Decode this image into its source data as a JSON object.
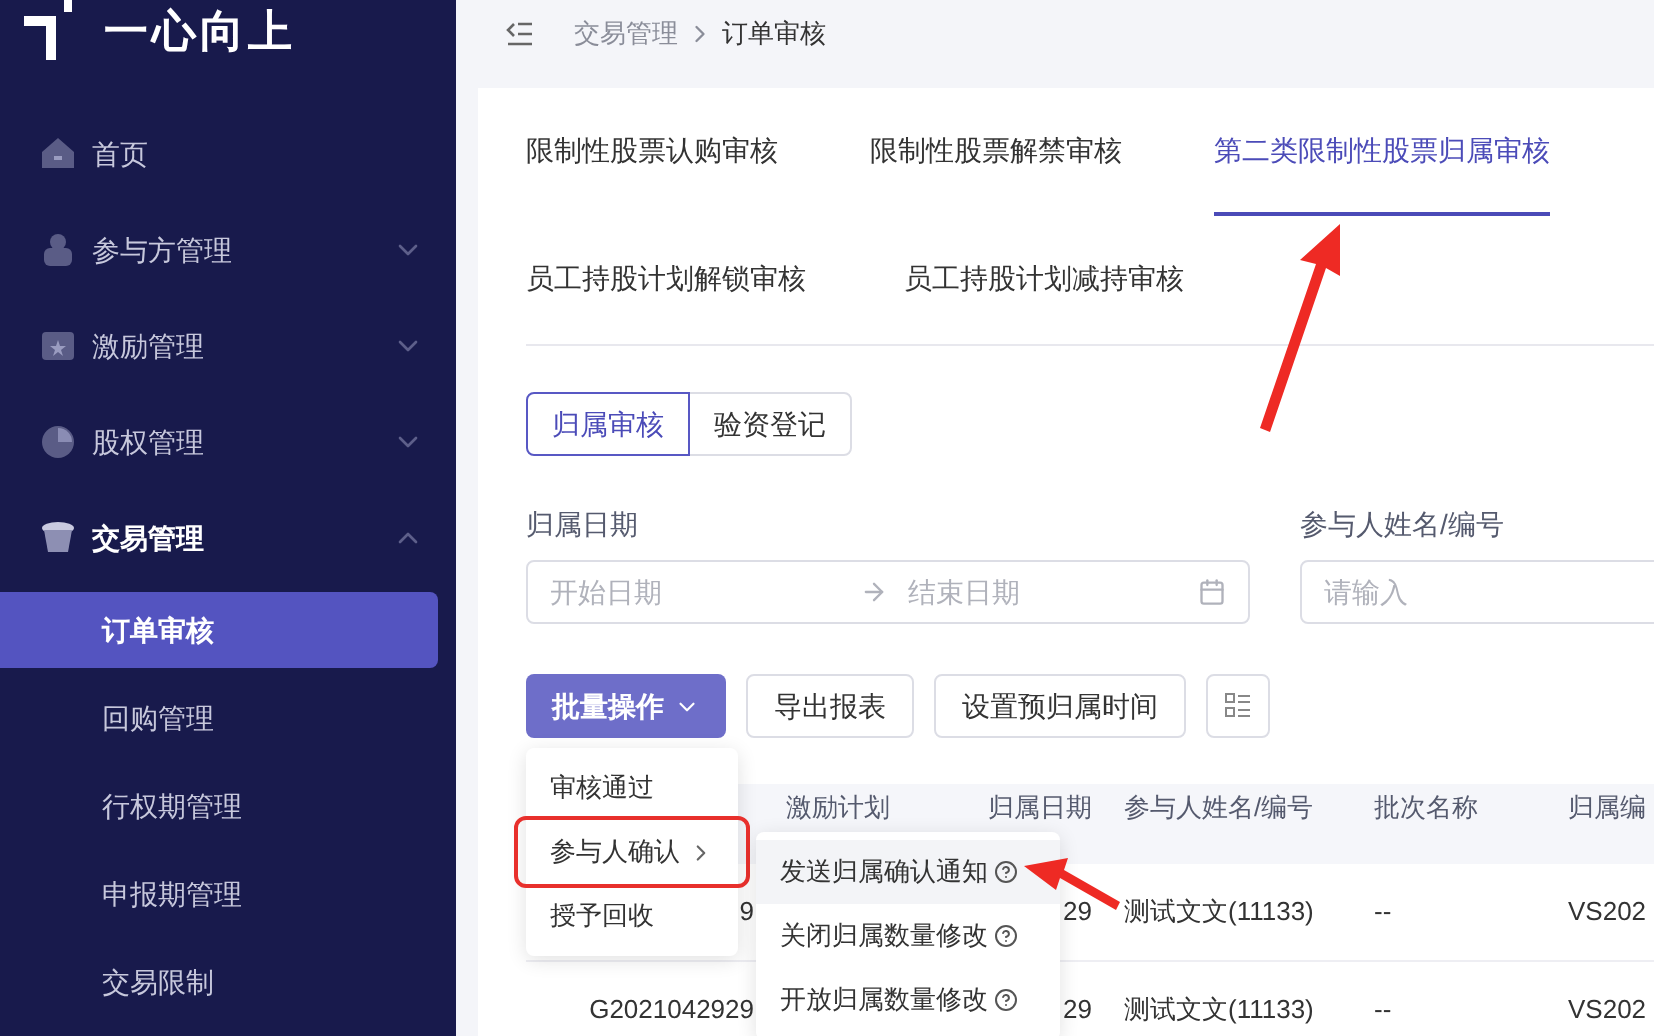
{
  "sidebar": {
    "logo": "一心向上",
    "items": [
      {
        "label": "首页",
        "expandable": false
      },
      {
        "label": "参与方管理",
        "expandable": true,
        "expanded": false
      },
      {
        "label": "激励管理",
        "expandable": true,
        "expanded": false
      },
      {
        "label": "股权管理",
        "expandable": true,
        "expanded": false
      },
      {
        "label": "交易管理",
        "expandable": true,
        "expanded": true,
        "children": [
          {
            "label": "订单审核",
            "selected": true
          },
          {
            "label": "回购管理",
            "selected": false
          },
          {
            "label": "行权期管理",
            "selected": false
          },
          {
            "label": "申报期管理",
            "selected": false
          },
          {
            "label": "交易限制",
            "selected": false
          }
        ]
      }
    ]
  },
  "breadcrumb": [
    "交易管理",
    "订单审核"
  ],
  "tabs": [
    [
      {
        "label": "限制性股票认购审核",
        "selected": false
      },
      {
        "label": "限制性股票解禁审核",
        "selected": false
      },
      {
        "label": "第二类限制性股票归属审核",
        "selected": true
      }
    ],
    [
      {
        "label": "员工持股计划解锁审核",
        "selected": false
      },
      {
        "label": "员工持股计划减持审核",
        "selected": false
      }
    ]
  ],
  "segments": [
    {
      "label": "归属审核",
      "selected": true
    },
    {
      "label": "验资登记",
      "selected": false
    }
  ],
  "filters": {
    "date_label": "归属日期",
    "date_start_placeholder": "开始日期",
    "date_end_placeholder": "结束日期",
    "name_label": "参与人姓名/编号",
    "name_placeholder": "请输入"
  },
  "toolbar": {
    "batch": "批量操作",
    "export": "导出报表",
    "set_time": "设置预归属时间"
  },
  "table": {
    "columns": [
      "",
      "激励计划",
      "归属日期",
      "参与人姓名/编号",
      "批次名称",
      "归属编"
    ],
    "rows": [
      [
        "9",
        "",
        "29",
        "测试文文(11133)",
        "--",
        "VS202"
      ],
      [
        "G2021042929",
        "",
        "29",
        "测试文文(11133)",
        "--",
        "VS202"
      ]
    ]
  },
  "batch_menu": [
    {
      "label": "审核通过",
      "submenu": false,
      "highlighted": false
    },
    {
      "label": "参与人确认",
      "submenu": true,
      "highlighted": true
    },
    {
      "label": "授予回收",
      "submenu": false,
      "highlighted": false
    }
  ],
  "submenu": [
    {
      "label": "发送归属确认通知",
      "hovered": true
    },
    {
      "label": "关闭归属数量修改",
      "hovered": false
    },
    {
      "label": "开放归属数量修改",
      "hovered": false
    }
  ]
}
